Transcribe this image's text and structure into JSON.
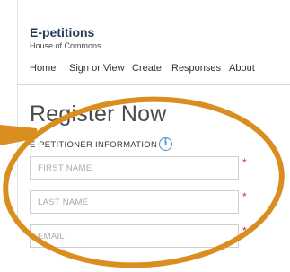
{
  "header": {
    "title": "E-petitions",
    "subtitle": "House of Commons"
  },
  "nav": {
    "items": [
      {
        "label": "Home"
      },
      {
        "label": "Sign or View"
      },
      {
        "label": "Create"
      },
      {
        "label": "Responses"
      },
      {
        "label": "About"
      }
    ]
  },
  "main": {
    "heading": "Register Now",
    "section_label": "E-PETITIONER INFORMATION",
    "info_icon": "info-icon",
    "fields": {
      "first_name": {
        "placeholder": "FIRST NAME",
        "value": "",
        "required_mark": "*"
      },
      "last_name": {
        "placeholder": "LAST NAME",
        "value": "",
        "required_mark": "*"
      },
      "email": {
        "placeholder": "EMAIL",
        "value": "",
        "required_mark": "*"
      }
    }
  },
  "annotation": {
    "shape": "ellipse-highlight",
    "pointer": "arrow",
    "color": "#d98e1f"
  },
  "colors": {
    "brand": "#1f3b5a",
    "info": "#3f93c9",
    "required": "#d0313b",
    "highlight": "#d98e1f"
  }
}
